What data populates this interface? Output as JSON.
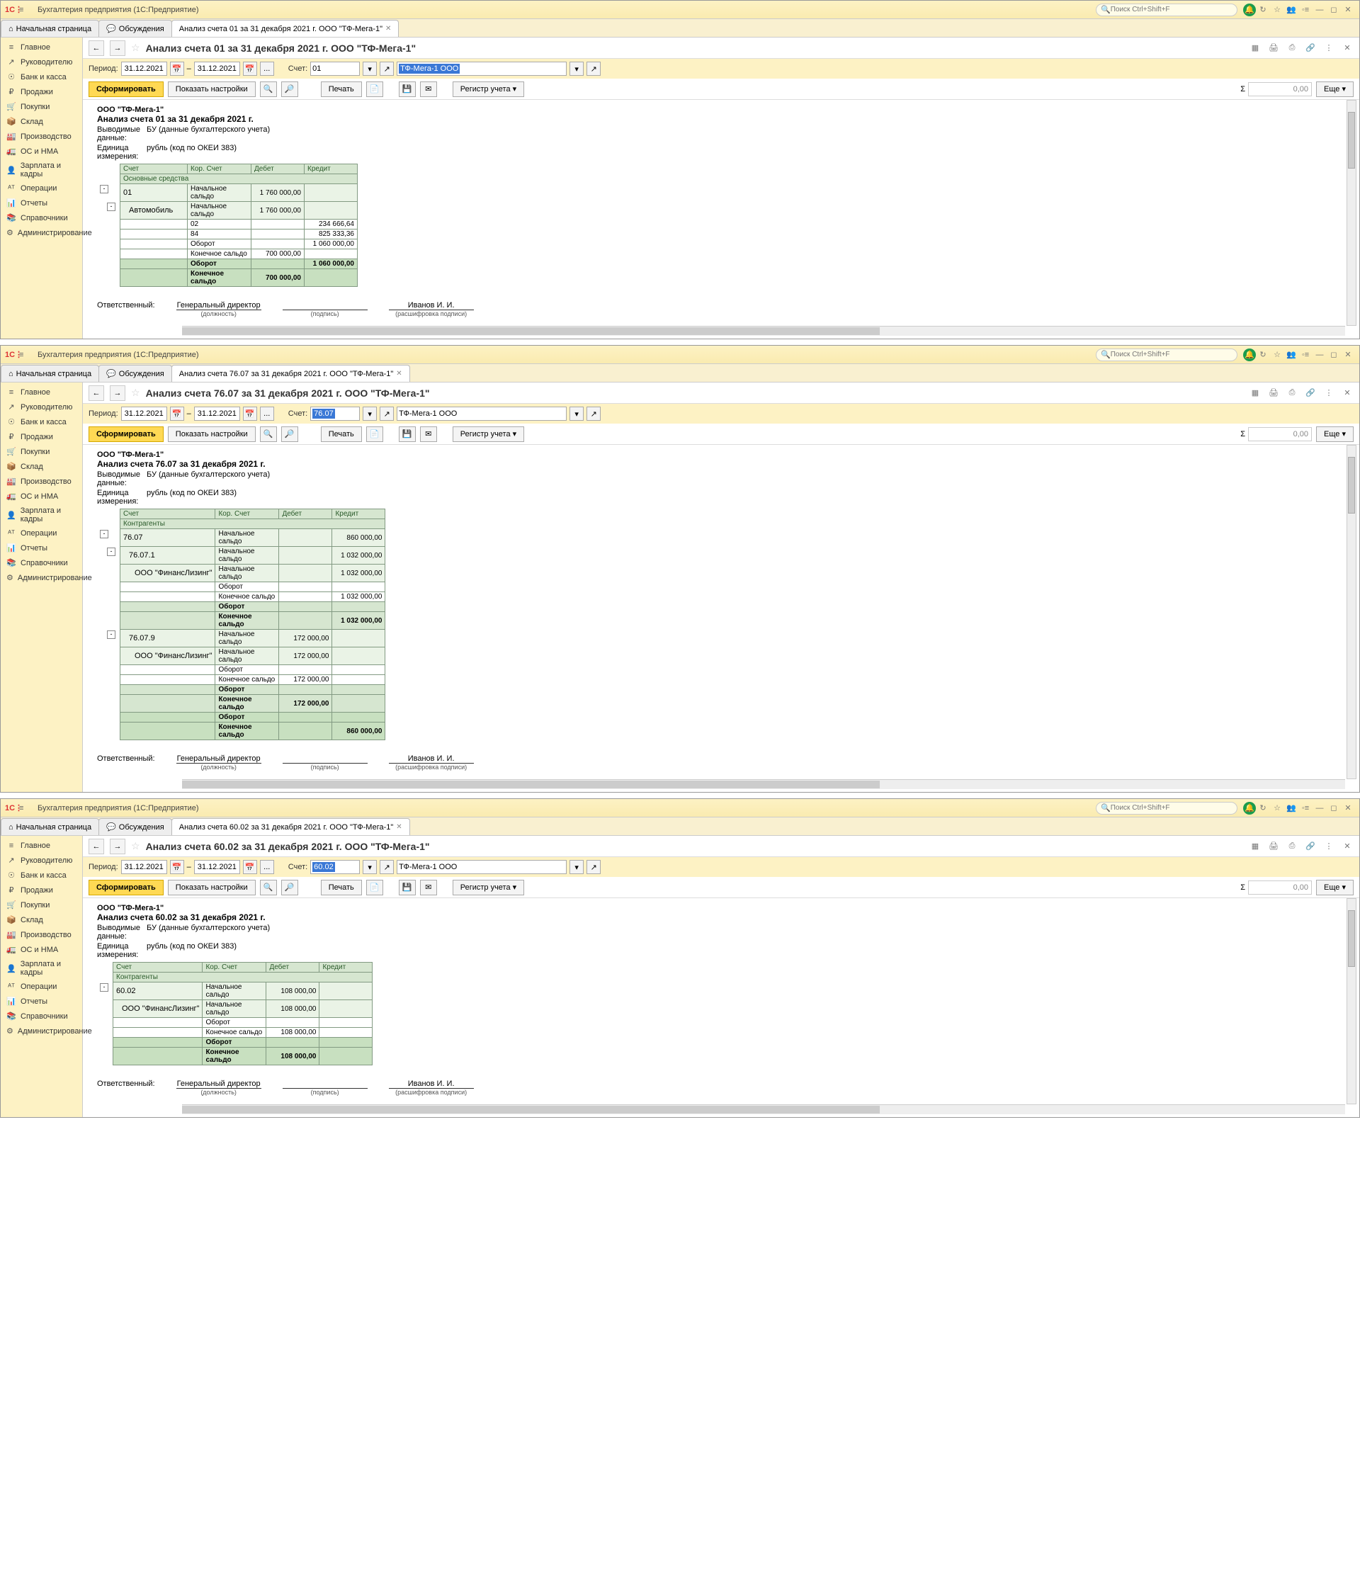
{
  "global": {
    "appTitle": "Бухгалтерия предприятия  (1С:Предприятие)",
    "searchPlaceholder": "Поиск Ctrl+Shift+F",
    "homeTab": "Начальная страница",
    "discussTab": "Обсуждения",
    "navItems": [
      "Главное",
      "Руководителю",
      "Банк и касса",
      "Продажи",
      "Покупки",
      "Склад",
      "Производство",
      "ОС и НМА",
      "Зарплата и кадры",
      "Операции",
      "Отчеты",
      "Справочники",
      "Администрирование"
    ],
    "navIcons": [
      "≡",
      "↗",
      "☉",
      "₽",
      "🛒",
      "📦",
      "🏭",
      "🚛",
      "👤",
      "ᴬᵀ",
      "📊",
      "📚",
      "⚙"
    ],
    "periodLabel": "Период:",
    "accountLabel": "Счет:",
    "dateFrom": "31.12.2021",
    "dateTo": "31.12.2021",
    "orgInput": "ТФ-Мега-1 ООО",
    "orgSelected": "ТФ-Мега-1 ООО",
    "btnForm": "Сформировать",
    "btnSettings": "Показать настройки",
    "btnPrint": "Печать",
    "btnRegister": "Регистр учета ▾",
    "btnMore": "Еще ▾",
    "sumValue": "0,00",
    "reportOrg": "ООО \"ТФ-Мега-1\"",
    "outDataLbl": "Выводимые данные:",
    "outDataVal": "БУ (данные бухгалтерского учета)",
    "unitLbl": "Единица измерения:",
    "unitVal": "рубль (код по ОКЕИ 383)",
    "colAccount": "Счет",
    "colCorr": "Кор. Счет",
    "colDebit": "Дебет",
    "colCredit": "Кредит",
    "txtBegin": "Начальное сальдо",
    "txtTurn": "Оборот",
    "txtEnd": "Конечное сальдо",
    "respLbl": "Ответственный:",
    "respName": "Генеральный директор",
    "respPos": "(должность)",
    "signLbl": "(подпись)",
    "respPerson": "Иванов И. И.",
    "decryptLbl": "(расшифровка подписи)"
  },
  "windows": [
    {
      "tabTitle": "Анализ счета 01 за 31 декабря 2021 г. ООО \"ТФ-Мега-1\"",
      "pageTitle": "Анализ счета 01 за 31 декабря 2021 г. ООО \"ТФ-Мега-1\"",
      "account": "01",
      "accountSelected": false,
      "orgSelected": true,
      "reportTitle": "Анализ счета 01 за 31 декабря 2021 г.",
      "groupLabel": "Основные средства",
      "rows": [
        {
          "type": "acct",
          "indent": 0,
          "toggle": "-",
          "acct": "01",
          "corr": "Начальное сальдо",
          "debit": "1 760 000,00",
          "credit": ""
        },
        {
          "type": "sub",
          "indent": 1,
          "toggle": "-",
          "acct": "Автомобиль",
          "corr": "Начальное сальдо",
          "debit": "1 760 000,00",
          "credit": ""
        },
        {
          "type": "line",
          "indent": 2,
          "acct": "",
          "corr": "02",
          "debit": "",
          "credit": "234 666,64"
        },
        {
          "type": "line",
          "indent": 2,
          "acct": "",
          "corr": "84",
          "debit": "",
          "credit": "825 333,36"
        },
        {
          "type": "line",
          "indent": 2,
          "acct": "",
          "corr": "Оборот",
          "debit": "",
          "credit": "1 060 000,00"
        },
        {
          "type": "line",
          "indent": 2,
          "acct": "",
          "corr": "Конечное сальдо",
          "debit": "700 000,00",
          "credit": ""
        },
        {
          "type": "total",
          "acct": "",
          "corr": "Оборот",
          "debit": "",
          "credit": "1 060 000,00"
        },
        {
          "type": "total",
          "acct": "",
          "corr": "Конечное сальдо",
          "debit": "700 000,00",
          "credit": ""
        }
      ]
    },
    {
      "tabTitle": "Анализ счета 76.07 за 31 декабря 2021 г. ООО \"ТФ-Мега-1\"",
      "pageTitle": "Анализ счета 76.07 за 31 декабря 2021 г. ООО \"ТФ-Мега-1\"",
      "account": "76.07",
      "accountSelected": true,
      "orgSelected": false,
      "reportTitle": "Анализ счета 76.07 за 31 декабря 2021 г.",
      "groupLabel": "Контрагенты",
      "rows": [
        {
          "type": "acct",
          "indent": 0,
          "toggle": "-",
          "acct": "76.07",
          "corr": "Начальное сальдо",
          "debit": "",
          "credit": "860 000,00"
        },
        {
          "type": "sub",
          "indent": 1,
          "toggle": "-",
          "acct": "76.07.1",
          "corr": "Начальное сальдо",
          "debit": "",
          "credit": "1 032 000,00"
        },
        {
          "type": "sub",
          "indent": 2,
          "toggle": "",
          "acct": "ООО \"ФинансЛизинг\"",
          "corr": "Начальное сальдо",
          "debit": "",
          "credit": "1 032 000,00"
        },
        {
          "type": "line",
          "indent": 3,
          "acct": "",
          "corr": "Оборот",
          "debit": "",
          "credit": ""
        },
        {
          "type": "line",
          "indent": 3,
          "acct": "",
          "corr": "Конечное сальдо",
          "debit": "",
          "credit": "1 032 000,00"
        },
        {
          "type": "subtotal",
          "acct": "",
          "corr": "Оборот",
          "debit": "",
          "credit": ""
        },
        {
          "type": "subtotal",
          "acct": "",
          "corr": "Конечное сальдо",
          "debit": "",
          "credit": "1 032 000,00"
        },
        {
          "type": "sub",
          "indent": 1,
          "toggle": "-",
          "acct": "76.07.9",
          "corr": "Начальное сальдо",
          "debit": "172 000,00",
          "credit": ""
        },
        {
          "type": "sub",
          "indent": 2,
          "toggle": "",
          "acct": "ООО \"ФинансЛизинг\"",
          "corr": "Начальное сальдо",
          "debit": "172 000,00",
          "credit": ""
        },
        {
          "type": "line",
          "indent": 3,
          "acct": "",
          "corr": "Оборот",
          "debit": "",
          "credit": ""
        },
        {
          "type": "line",
          "indent": 3,
          "acct": "",
          "corr": "Конечное сальдо",
          "debit": "172 000,00",
          "credit": ""
        },
        {
          "type": "subtotal",
          "acct": "",
          "corr": "Оборот",
          "debit": "",
          "credit": ""
        },
        {
          "type": "subtotal",
          "acct": "",
          "corr": "Конечное сальдо",
          "debit": "172 000,00",
          "credit": ""
        },
        {
          "type": "total",
          "acct": "",
          "corr": "Оборот",
          "debit": "",
          "credit": ""
        },
        {
          "type": "total",
          "acct": "",
          "corr": "Конечное сальдо",
          "debit": "",
          "credit": "860 000,00"
        }
      ]
    },
    {
      "tabTitle": "Анализ счета 60.02 за 31 декабря 2021 г. ООО \"ТФ-Мега-1\"",
      "pageTitle": "Анализ счета 60.02 за 31 декабря 2021 г. ООО \"ТФ-Мега-1\"",
      "account": "60.02",
      "accountSelected": true,
      "orgSelected": false,
      "reportTitle": "Анализ счета 60.02 за 31 декабря 2021 г.",
      "groupLabel": "Контрагенты",
      "rows": [
        {
          "type": "acct",
          "indent": 0,
          "toggle": "-",
          "acct": "60.02",
          "corr": "Начальное сальдо",
          "debit": "108 000,00",
          "credit": ""
        },
        {
          "type": "sub",
          "indent": 1,
          "toggle": "",
          "acct": "ООО \"ФинансЛизинг\"",
          "corr": "Начальное сальдо",
          "debit": "108 000,00",
          "credit": ""
        },
        {
          "type": "line",
          "indent": 2,
          "acct": "",
          "corr": "Оборот",
          "debit": "",
          "credit": ""
        },
        {
          "type": "line",
          "indent": 2,
          "acct": "",
          "corr": "Конечное сальдо",
          "debit": "108 000,00",
          "credit": ""
        },
        {
          "type": "total",
          "acct": "",
          "corr": "Оборот",
          "debit": "",
          "credit": ""
        },
        {
          "type": "total",
          "acct": "",
          "corr": "Конечное сальдо",
          "debit": "108 000,00",
          "credit": ""
        }
      ]
    }
  ]
}
